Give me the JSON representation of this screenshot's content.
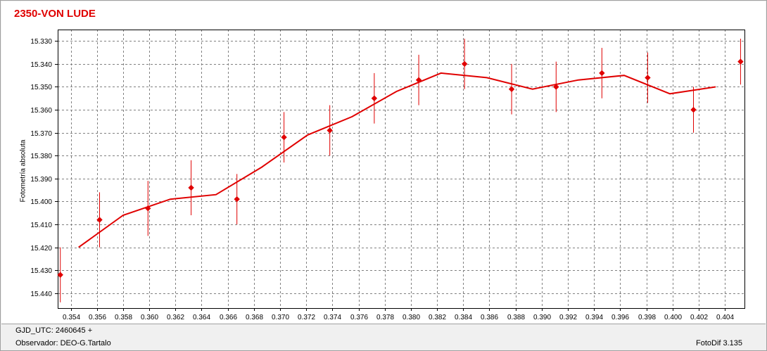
{
  "footer": {
    "gjd_label": "GJD_UTC: 2460645 +",
    "observer_label": "Observador: DEO-G.Tartalo",
    "software_label": "FotoDif 3.135"
  },
  "colors": {
    "series": "#e00000",
    "grid": "#808080",
    "title": "#e00000"
  },
  "chart_data": {
    "type": "scatter",
    "title": "2350-VON LUDE",
    "xlabel": "",
    "ylabel": "Fotometría absoluta",
    "xlim": [
      0.353,
      0.4055
    ],
    "ylim": [
      15.325,
      15.4465
    ],
    "y_inverted": true,
    "grid": true,
    "x_ticks": [
      "0.354",
      "0.356",
      "0.358",
      "0.360",
      "0.362",
      "0.364",
      "0.366",
      "0.368",
      "0.370",
      "0.372",
      "0.374",
      "0.376",
      "0.378",
      "0.380",
      "0.382",
      "0.384",
      "0.386",
      "0.388",
      "0.390",
      "0.392",
      "0.394",
      "0.396",
      "0.398",
      "0.400",
      "0.402",
      "0.404"
    ],
    "y_ticks": [
      "15.330",
      "15.340",
      "15.350",
      "15.360",
      "15.370",
      "15.380",
      "15.390",
      "15.400",
      "15.410",
      "15.420",
      "15.430",
      "15.440"
    ],
    "series": [
      {
        "kind": "points_with_error",
        "x": [
          0.3532,
          0.3562,
          0.3599,
          0.3632,
          0.3667,
          0.3703,
          0.3738,
          0.3772,
          0.3806,
          0.3841,
          0.3877,
          0.3911,
          0.3946,
          0.3981,
          0.4016,
          0.4052
        ],
        "y": [
          15.432,
          15.408,
          15.403,
          15.394,
          15.399,
          15.372,
          15.369,
          15.355,
          15.347,
          15.34,
          15.351,
          15.35,
          15.344,
          15.346,
          15.36,
          15.339
        ],
        "error": [
          0.012,
          0.012,
          0.012,
          0.012,
          0.011,
          0.011,
          0.011,
          0.011,
          0.011,
          0.011,
          0.011,
          0.011,
          0.011,
          0.011,
          0.01,
          0.01
        ]
      },
      {
        "kind": "line",
        "x": [
          0.3546,
          0.358,
          0.3616,
          0.3651,
          0.3686,
          0.3721,
          0.3755,
          0.3789,
          0.3823,
          0.3858,
          0.3893,
          0.3928,
          0.3963,
          0.3998,
          0.4033
        ],
        "y": [
          15.42,
          15.406,
          15.399,
          15.397,
          15.385,
          15.371,
          15.363,
          15.352,
          15.344,
          15.346,
          15.351,
          15.347,
          15.345,
          15.353,
          15.35
        ]
      }
    ]
  }
}
